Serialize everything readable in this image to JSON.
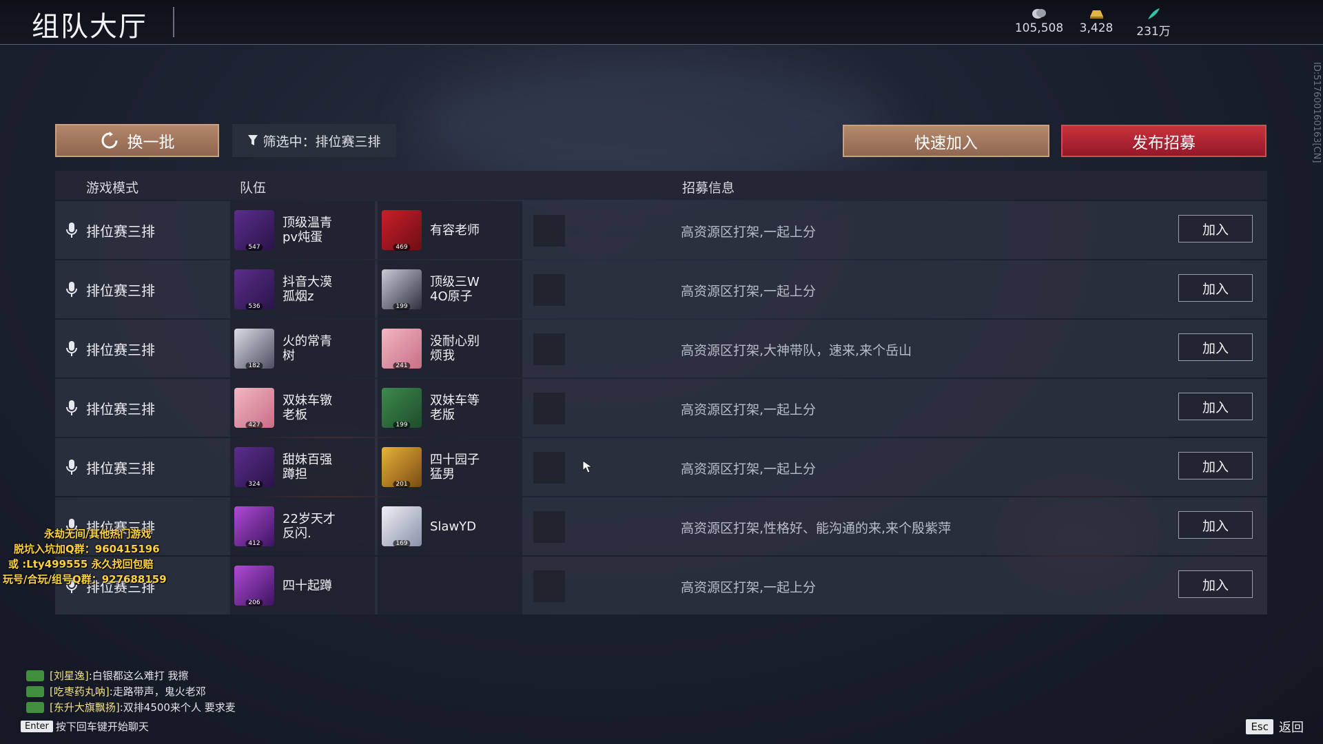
{
  "header": {
    "title": "组队大厅",
    "currencies": [
      {
        "icon": "coin-stack-icon",
        "value": "105,508"
      },
      {
        "icon": "gold-ingot-icon",
        "value": "3,428"
      },
      {
        "icon": "feather-icon",
        "value": "231万"
      }
    ],
    "side_id": "ID:517600160163[CN]"
  },
  "toolbar": {
    "refresh_label": "换一批",
    "filter_label": "筛选中：排位赛三排",
    "quick_join_label": "快速加入",
    "publish_label": "发布招募"
  },
  "table": {
    "headers": {
      "mode": "游戏模式",
      "team": "队伍",
      "info": "招募信息"
    },
    "rows": [
      {
        "mode": "排位赛三排",
        "members": [
          {
            "name": "顶级温青\npv炖蛋",
            "level": "547",
            "avatar": "frame-100-purple"
          },
          {
            "name": "有容老师",
            "level": "469",
            "avatar": "red-seal"
          }
        ],
        "info": "高资源区打架,一起上分",
        "join": "加入"
      },
      {
        "mode": "排位赛三排",
        "members": [
          {
            "name": "抖音大漠\n孤烟z",
            "level": "536",
            "avatar": "frame-100-purple"
          },
          {
            "name": "顶级三W\n4O原子",
            "level": "199",
            "avatar": "dark-hair"
          }
        ],
        "info": "高资源区打架,一起上分",
        "join": "加入"
      },
      {
        "mode": "排位赛三排",
        "members": [
          {
            "name": "火的常青\n树",
            "level": "182",
            "avatar": "white-hair"
          },
          {
            "name": "没耐心别\n烦我",
            "level": "241",
            "avatar": "pink-bunny"
          }
        ],
        "info": "高资源区打架,大神带队，速来,来个岳山",
        "join": "加入"
      },
      {
        "mode": "排位赛三排",
        "members": [
          {
            "name": "双妹车镦\n老板",
            "level": "427",
            "avatar": "pink-bunny"
          },
          {
            "name": "双妹车等\n老版",
            "level": "199",
            "avatar": "green-scroll"
          }
        ],
        "info": "高资源区打架,一起上分",
        "join": "加入"
      },
      {
        "mode": "排位赛三排",
        "members": [
          {
            "name": "甜妹百强\n蹲担",
            "level": "324",
            "avatar": "frame-100-purple"
          },
          {
            "name": "四十园子\n猛男",
            "level": "201",
            "avatar": "gold-seal"
          }
        ],
        "info": "高资源区打架,一起上分",
        "join": "加入"
      },
      {
        "mode": "排位赛三排",
        "members": [
          {
            "name": "22岁天才\n反闪.",
            "level": "412",
            "avatar": "purple-flame"
          },
          {
            "name": "SlawYD",
            "level": "169",
            "avatar": "white-cat"
          }
        ],
        "info": "高资源区打架,性格好、能沟通的来,来个殷紫萍",
        "join": "加入"
      },
      {
        "mode": "排位赛三排",
        "members": [
          {
            "name": "四十起蹲",
            "level": "206",
            "avatar": "purple-flame"
          }
        ],
        "info": "高资源区打架,一起上分",
        "join": "加入"
      }
    ]
  },
  "overlay": {
    "lines": [
      "永劫无间/其他热门游戏",
      "脱坑入坑加Q群：960415196",
      "或 :Lty499555 永久找回包赔",
      "玩号/合玩/组号Q群：927688159"
    ]
  },
  "chat": {
    "messages": [
      {
        "who": "[刘星逸]",
        "text": ":白银都这么难打  我擦"
      },
      {
        "who": "[吃枣药丸呐]",
        "text": ":走路带声，鬼火老邓"
      },
      {
        "who": "[东升大旗飘扬]",
        "text": ":双排4500来个人  要求麦"
      }
    ],
    "hint_key": "Enter",
    "hint_text": "按下回车键开始聊天"
  },
  "footer": {
    "esc_key": "Esc",
    "back_label": "返回"
  },
  "colors": {
    "accent_brown": "#b3876a",
    "accent_red": "#c8323b",
    "overlay_yellow": "#ffd23c"
  }
}
